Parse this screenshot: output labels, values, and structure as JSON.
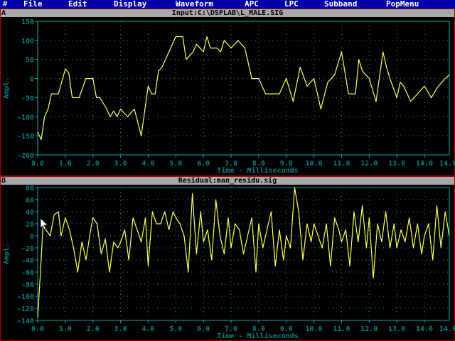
{
  "menu": {
    "corner_glyph": "#",
    "items": [
      "File",
      "Edit",
      "Display",
      "Waveform",
      "APC",
      "LPC",
      "Subband",
      "PopMenu"
    ]
  },
  "colors": {
    "menubar": "#0000a8",
    "title_bar": "#a8a8a8",
    "plot_border": "#00a8a8",
    "tick_text": "#008080",
    "waveform": "#ffff55",
    "window_border": "#a80000"
  },
  "panels": [
    {
      "letter": "A",
      "title": "Input:C:\\DSPLAB\\L_MALE.SIG",
      "ylabel": "Ampl.",
      "xlabel": "Time - Milliseconds",
      "y_ticks": [
        "150",
        "100",
        "50",
        "0",
        "-50",
        "-100",
        "-150",
        "-200"
      ],
      "x_ticks": [
        "0.0",
        "1.0",
        "2.0",
        "3.0",
        "4.0",
        "5.0",
        "6.0",
        "7.0",
        "8.0",
        "9.0",
        "10.0",
        "11.0",
        "12.0",
        "13.0",
        "14.0"
      ]
    },
    {
      "letter": "B",
      "title": "Residual:man_residu.sig",
      "ylabel": "Ampl.",
      "xlabel": "Time - Milliseconds",
      "y_ticks": [
        "80",
        "60",
        "40",
        "20",
        "0",
        "-20",
        "-40",
        "-60",
        "-80",
        "-100",
        "-120",
        "-140"
      ],
      "x_ticks": [
        "0.0",
        "1.0",
        "2.0",
        "3.0",
        "4.0",
        "5.0",
        "6.0",
        "7.0",
        "8.0",
        "9.0",
        "10.0",
        "11.0",
        "12.0",
        "13.0",
        "14.0"
      ]
    }
  ],
  "chart_data": [
    {
      "type": "line",
      "title": "Input:C:\\DSPLAB\\L_MALE.SIG",
      "xlabel": "Time - Milliseconds",
      "ylabel": "Ampl.",
      "xlim": [
        0,
        14.9
      ],
      "ylim": [
        -200,
        150
      ],
      "grid": true,
      "series": [
        {
          "x": [
            0.0,
            0.125,
            0.25,
            0.375,
            0.5,
            0.75,
            1.0,
            1.125,
            1.25,
            1.375,
            1.5,
            1.75,
            2.0,
            2.125,
            2.25,
            2.5,
            2.625,
            2.75,
            2.875,
            3.0,
            3.25,
            3.5,
            3.75,
            4.0,
            4.125,
            4.25,
            4.375,
            4.5,
            4.75,
            5.0,
            5.25,
            5.375,
            5.5,
            5.625,
            5.75,
            6.0,
            6.125,
            6.25,
            6.5,
            6.625,
            6.75,
            7.0,
            7.25,
            7.5,
            7.75,
            8.0,
            8.25,
            8.5,
            8.75,
            9.0,
            9.25,
            9.5,
            9.75,
            10.0,
            10.25,
            10.5,
            10.75,
            11.0,
            11.25,
            11.5,
            11.625,
            11.75,
            12.0,
            12.25,
            12.5,
            12.625,
            12.75,
            13.0,
            13.125,
            13.25,
            13.5,
            13.75,
            14.0,
            14.25,
            14.5,
            14.75,
            14.9
          ],
          "values": [
            -140,
            -160,
            -100,
            -80,
            -40,
            -40,
            25,
            15,
            -50,
            -50,
            -50,
            0,
            0,
            -50,
            -50,
            -80,
            -100,
            -85,
            -100,
            -80,
            -100,
            -80,
            -150,
            -20,
            -40,
            -40,
            20,
            30,
            70,
            110,
            110,
            50,
            60,
            70,
            90,
            70,
            110,
            80,
            80,
            70,
            100,
            80,
            100,
            80,
            0,
            0,
            -40,
            -40,
            -40,
            0,
            -60,
            30,
            -20,
            0,
            -80,
            -10,
            10,
            70,
            -40,
            -40,
            50,
            20,
            0,
            -60,
            70,
            30,
            0,
            -50,
            -10,
            -20,
            -60,
            -40,
            -20,
            -50,
            -20,
            0,
            10
          ]
        }
      ]
    },
    {
      "type": "line",
      "title": "Residual:man_residu.sig",
      "xlabel": "Time - Milliseconds",
      "ylabel": "Ampl.",
      "xlim": [
        0,
        14.9
      ],
      "ylim": [
        -140,
        80
      ],
      "grid": true,
      "series": [
        {
          "x": [
            0.0,
            0.1,
            0.2,
            0.3,
            0.45,
            0.6,
            0.75,
            0.85,
            1.0,
            1.15,
            1.3,
            1.45,
            1.6,
            1.75,
            1.9,
            2.0,
            2.15,
            2.3,
            2.45,
            2.6,
            2.75,
            2.9,
            3.0,
            3.15,
            3.3,
            3.45,
            3.6,
            3.75,
            3.9,
            4.0,
            4.15,
            4.3,
            4.45,
            4.6,
            4.75,
            4.9,
            5.0,
            5.15,
            5.3,
            5.45,
            5.6,
            5.75,
            5.9,
            6.0,
            6.15,
            6.3,
            6.45,
            6.6,
            6.75,
            6.9,
            7.0,
            7.15,
            7.3,
            7.45,
            7.6,
            7.75,
            7.9,
            8.0,
            8.15,
            8.3,
            8.45,
            8.6,
            8.75,
            8.9,
            9.0,
            9.15,
            9.3,
            9.45,
            9.6,
            9.75,
            9.9,
            10.0,
            10.15,
            10.3,
            10.45,
            10.6,
            10.75,
            10.9,
            11.0,
            11.15,
            11.3,
            11.45,
            11.6,
            11.75,
            11.9,
            12.0,
            12.15,
            12.3,
            12.45,
            12.6,
            12.75,
            12.9,
            13.0,
            13.15,
            13.3,
            13.45,
            13.6,
            13.75,
            13.9,
            14.0,
            14.15,
            14.3,
            14.45,
            14.6,
            14.75,
            14.9
          ],
          "values": [
            -135,
            -60,
            25,
            10,
            0,
            35,
            40,
            0,
            30,
            10,
            -20,
            -60,
            -10,
            -40,
            5,
            30,
            20,
            -30,
            -5,
            -60,
            -10,
            -20,
            -10,
            10,
            -40,
            30,
            10,
            -10,
            30,
            -50,
            40,
            20,
            20,
            40,
            10,
            40,
            30,
            20,
            0,
            -60,
            70,
            -30,
            40,
            -10,
            10,
            -40,
            60,
            0,
            -30,
            30,
            -20,
            20,
            10,
            -30,
            0,
            30,
            -60,
            20,
            -20,
            10,
            40,
            -50,
            10,
            -40,
            0,
            -20,
            80,
            40,
            -40,
            20,
            -10,
            20,
            0,
            -20,
            20,
            -50,
            30,
            10,
            -10,
            10,
            -50,
            40,
            -10,
            50,
            -20,
            30,
            -70,
            20,
            -10,
            40,
            -20,
            20,
            -20,
            10,
            -10,
            30,
            -20,
            20,
            -30,
            0,
            20,
            -40,
            50,
            -20,
            40,
            0
          ]
        }
      ]
    }
  ]
}
